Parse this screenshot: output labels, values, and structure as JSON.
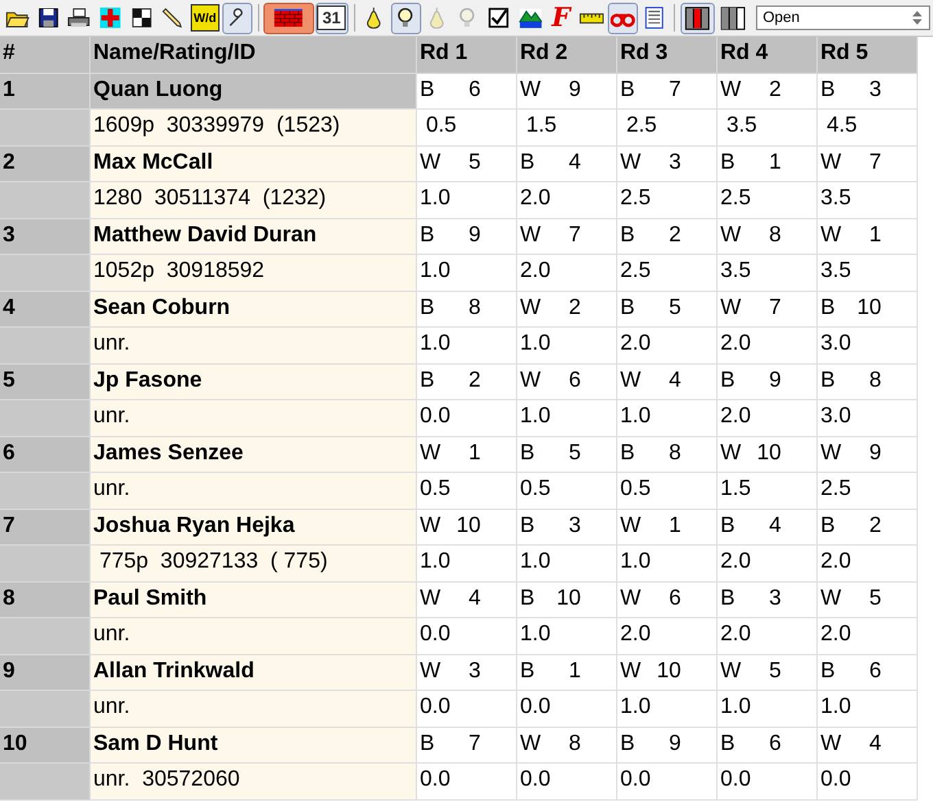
{
  "toolbar": [
    {
      "kind": "folder"
    },
    {
      "kind": "save"
    },
    {
      "kind": "printer"
    },
    {
      "kind": "plus"
    },
    {
      "kind": "checker"
    },
    {
      "kind": "pencil"
    },
    {
      "kind": "wd",
      "label": "W/d"
    },
    {
      "kind": "wrench",
      "pressed": true
    },
    {
      "kind": "sep"
    },
    {
      "kind": "wall",
      "pressed": true
    },
    {
      "kind": "calendar",
      "label": "31",
      "pressed": true
    },
    {
      "kind": "sep"
    },
    {
      "kind": "pear"
    },
    {
      "kind": "bulb",
      "pressed": true
    },
    {
      "kind": "pear",
      "disabled": true
    },
    {
      "kind": "bulb",
      "disabled": true
    },
    {
      "kind": "checkbox"
    },
    {
      "kind": "landscape"
    },
    {
      "kind": "letter",
      "label": "F"
    },
    {
      "kind": "ruler"
    },
    {
      "kind": "binoculars",
      "pressed": true
    },
    {
      "kind": "list"
    },
    {
      "kind": "sep"
    },
    {
      "kind": "redcolumn",
      "pressed": true
    },
    {
      "kind": "columns"
    }
  ],
  "dropdown": {
    "value": "Open"
  },
  "table": {
    "columns": [
      "#",
      "Name/Rating/ID",
      "Rd 1",
      "Rd 2",
      "Rd 3",
      "Rd 4",
      "Rd 5"
    ],
    "players": [
      {
        "number": "1",
        "name": "Quan Luong",
        "info": "1609p  30339979  (1523)",
        "selected": true,
        "pairings": [
          [
            "B",
            "6"
          ],
          [
            "W",
            "9"
          ],
          [
            "B",
            "7"
          ],
          [
            "W",
            "2"
          ],
          [
            "B",
            "3"
          ]
        ],
        "scores": [
          " 0.5",
          " 1.5",
          " 2.5",
          " 3.5",
          " 4.5"
        ]
      },
      {
        "number": "2",
        "name": "Max McCall",
        "info": "1280  30511374  (1232)",
        "selected": false,
        "pairings": [
          [
            "W",
            "5"
          ],
          [
            "B",
            "4"
          ],
          [
            "W",
            "3"
          ],
          [
            "B",
            "1"
          ],
          [
            "W",
            "7"
          ]
        ],
        "scores": [
          "1.0",
          "2.0",
          "2.5",
          "2.5",
          "3.5"
        ]
      },
      {
        "number": "3",
        "name": "Matthew David Duran",
        "info": "1052p  30918592",
        "selected": false,
        "pairings": [
          [
            "B",
            "9"
          ],
          [
            "W",
            "7"
          ],
          [
            "B",
            "2"
          ],
          [
            "W",
            "8"
          ],
          [
            "W",
            "1"
          ]
        ],
        "scores": [
          "1.0",
          "2.0",
          "2.5",
          "3.5",
          "3.5"
        ]
      },
      {
        "number": "4",
        "name": "Sean Coburn",
        "info": "unr.",
        "selected": false,
        "pairings": [
          [
            "B",
            "8"
          ],
          [
            "W",
            "2"
          ],
          [
            "B",
            "5"
          ],
          [
            "W",
            "7"
          ],
          [
            "B",
            "10"
          ]
        ],
        "scores": [
          "1.0",
          "1.0",
          "2.0",
          "2.0",
          "3.0"
        ]
      },
      {
        "number": "5",
        "name": "Jp Fasone",
        "info": "unr.",
        "selected": false,
        "pairings": [
          [
            "B",
            "2"
          ],
          [
            "W",
            "6"
          ],
          [
            "W",
            "4"
          ],
          [
            "B",
            "9"
          ],
          [
            "B",
            "8"
          ]
        ],
        "scores": [
          "0.0",
          "1.0",
          "1.0",
          "2.0",
          "3.0"
        ]
      },
      {
        "number": "6",
        "name": "James Senzee",
        "info": "unr.",
        "selected": false,
        "pairings": [
          [
            "W",
            "1"
          ],
          [
            "B",
            "5"
          ],
          [
            "B",
            "8"
          ],
          [
            "W",
            "10"
          ],
          [
            "W",
            "9"
          ]
        ],
        "scores": [
          "0.5",
          "0.5",
          "0.5",
          "1.5",
          "2.5"
        ]
      },
      {
        "number": "7",
        "name": "Joshua Ryan Hejka",
        "info": " 775p  30927133  ( 775)",
        "selected": false,
        "pairings": [
          [
            "W",
            "10"
          ],
          [
            "B",
            "3"
          ],
          [
            "W",
            "1"
          ],
          [
            "B",
            "4"
          ],
          [
            "B",
            "2"
          ]
        ],
        "scores": [
          "1.0",
          "1.0",
          "1.0",
          "2.0",
          "2.0"
        ]
      },
      {
        "number": "8",
        "name": "Paul Smith",
        "info": "unr.",
        "selected": false,
        "pairings": [
          [
            "W",
            "4"
          ],
          [
            "B",
            "10"
          ],
          [
            "W",
            "6"
          ],
          [
            "B",
            "3"
          ],
          [
            "W",
            "5"
          ]
        ],
        "scores": [
          "0.0",
          "1.0",
          "2.0",
          "2.0",
          "2.0"
        ]
      },
      {
        "number": "9",
        "name": "Allan Trinkwald",
        "info": "unr.",
        "selected": false,
        "pairings": [
          [
            "W",
            "3"
          ],
          [
            "B",
            "1"
          ],
          [
            "W",
            "10"
          ],
          [
            "W",
            "5"
          ],
          [
            "B",
            "6"
          ]
        ],
        "scores": [
          "0.0",
          "0.0",
          "1.0",
          "1.0",
          "1.0"
        ]
      },
      {
        "number": "10",
        "name": "Sam D Hunt",
        "info": "unr.  30572060",
        "selected": false,
        "pairings": [
          [
            "B",
            "7"
          ],
          [
            "W",
            "8"
          ],
          [
            "B",
            "9"
          ],
          [
            "B",
            "6"
          ],
          [
            "W",
            "4"
          ]
        ],
        "scores": [
          "0.0",
          "0.0",
          "0.0",
          "0.0",
          "0.0"
        ]
      }
    ]
  }
}
